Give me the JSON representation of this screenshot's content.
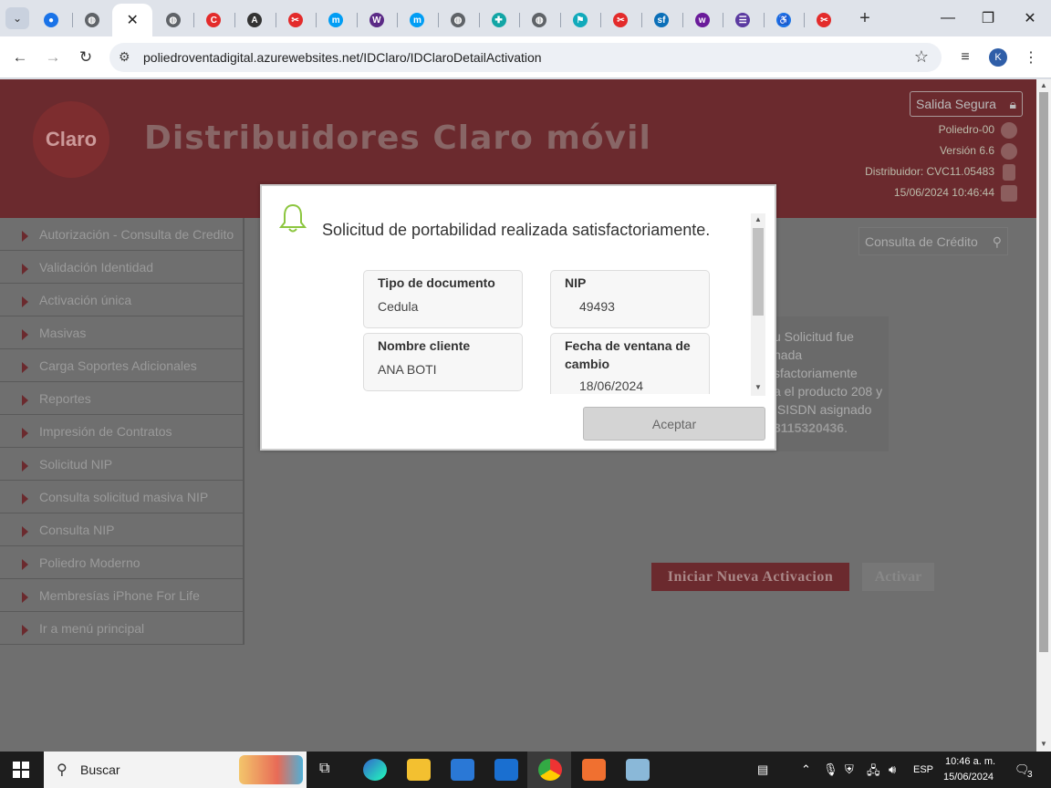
{
  "browser": {
    "tabs": [
      {
        "icon": "google-account-icon",
        "color": "#1a73e8"
      },
      {
        "icon": "globe-icon",
        "color": "#5f6368"
      },
      {
        "icon": "close-icon",
        "active": true
      },
      {
        "icon": "globe-icon",
        "color": "#5f6368"
      },
      {
        "icon": "claro-c-icon",
        "color": "#e32b2b"
      },
      {
        "icon": "angular-icon",
        "color": "#333"
      },
      {
        "icon": "claro-icon",
        "color": "#e32b2b"
      },
      {
        "icon": "movistar-icon",
        "color": "#019df4"
      },
      {
        "icon": "wikipedia-icon",
        "color": "#5b2a86"
      },
      {
        "icon": "movistar-icon",
        "color": "#019df4"
      },
      {
        "icon": "globe-icon",
        "color": "#5f6368"
      },
      {
        "icon": "medical-cross-icon",
        "color": "#12a5a5"
      },
      {
        "icon": "globe-icon",
        "color": "#5f6368"
      },
      {
        "icon": "runner-icon",
        "color": "#1ab"
      },
      {
        "icon": "claro-icon",
        "color": "#e32b2b"
      },
      {
        "icon": "sf-icon",
        "color": "#0b6fb8"
      },
      {
        "icon": "wom-icon",
        "color": "#6a1b9a"
      },
      {
        "icon": "list-icon",
        "color": "#5b3aa0"
      },
      {
        "icon": "accessibility-icon",
        "color": "#1a73e8"
      },
      {
        "icon": "claro-icon",
        "color": "#e32b2b"
      }
    ],
    "new_tab": "+",
    "window_controls": {
      "minimize": "—",
      "maximize": "❐",
      "close": "✕"
    },
    "nav": {
      "back": "←",
      "forward": "→",
      "reload": "↻"
    },
    "url": "poliedroventadigital.azurewebsites.net/IDClaro/IDClaroDetailActivation",
    "profile_initial": "K"
  },
  "header": {
    "logo_text": "Claro",
    "title": "Distribuidores Claro móvil",
    "logout_label": "Salida Segura",
    "info_lines": [
      "Poliedro-00",
      "Versión 6.6",
      "Distribuidor: CVC11.05483",
      "15/06/2024 10:46:44"
    ]
  },
  "sidebar": {
    "items": [
      {
        "label": "Autorización - Consulta de Credito"
      },
      {
        "label": "Validación Identidad"
      },
      {
        "label": "Activación única"
      },
      {
        "label": "Masivas"
      },
      {
        "label": "Carga Soportes Adicionales"
      },
      {
        "label": "Reportes"
      },
      {
        "label": "Impresión de Contratos"
      },
      {
        "label": "Solicitud NIP"
      },
      {
        "label": "Consulta solicitud masiva NIP"
      },
      {
        "label": "Consulta NIP"
      },
      {
        "label": "Poliedro Moderno"
      },
      {
        "label": "Membresías iPhone For Life"
      },
      {
        "label": "Ir a menú principal"
      }
    ]
  },
  "main": {
    "credit_button": "Consulta de Crédito",
    "result_lines": [
      "u Solicitud fue",
      "nada",
      "sfactoriamente",
      "a el producto 208 y",
      "ISISDN asignado"
    ],
    "result_number": "3115320436",
    "result_suffix": ".",
    "new_activation_label": "Iniciar Nueva Activacion",
    "activate_label": "Activar"
  },
  "modal": {
    "title": "Solicitud de portabilidad realizada satisfactoriamente.",
    "fields": {
      "doc_type": {
        "label": "Tipo de documento",
        "value": "Cedula"
      },
      "nip": {
        "label": "NIP",
        "value": "49493"
      },
      "client_name": {
        "label": "Nombre cliente",
        "value": "ANA BOTI"
      },
      "window_date": {
        "label": "Fecha de ventana de cambio",
        "value": "18/06/2024"
      }
    },
    "accept_label": "Aceptar"
  },
  "taskbar": {
    "search_placeholder": "Buscar",
    "language": "ESP",
    "time": "10:46 a. m.",
    "date": "15/06/2024",
    "notification_count": "3"
  }
}
